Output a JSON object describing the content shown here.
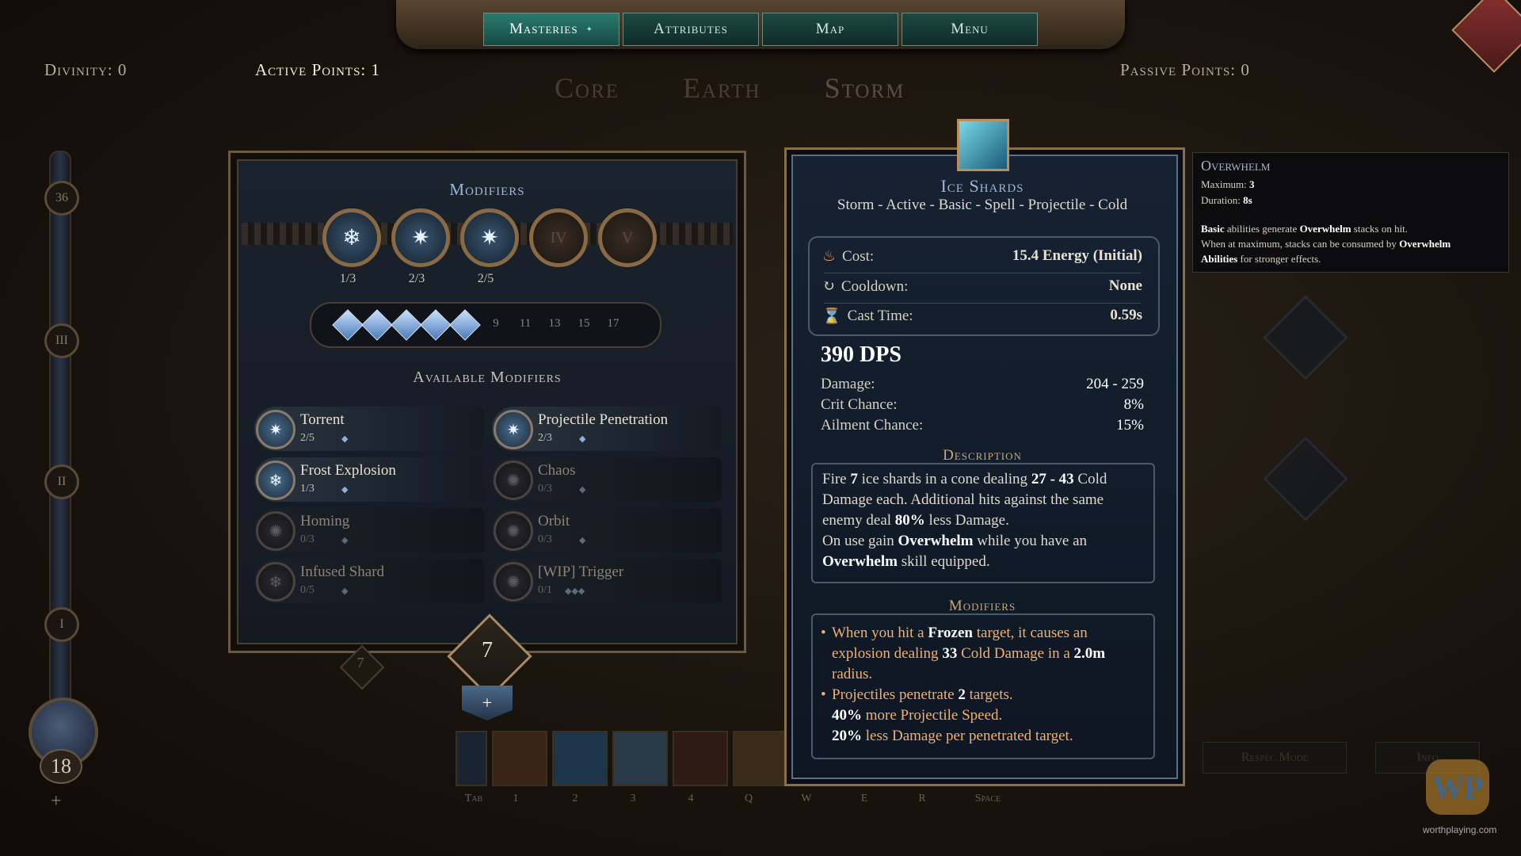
{
  "nav": {
    "tabs": [
      {
        "label": "Masteries",
        "active": true
      },
      {
        "label": "Attributes",
        "active": false
      },
      {
        "label": "Map",
        "active": false
      },
      {
        "label": "Menu",
        "active": false
      }
    ]
  },
  "header": {
    "divinity": "Divinity: 0",
    "active_points": "Active Points: 1",
    "passive_points": "Passive Points: 0",
    "tree_tabs": [
      "Core",
      "Earth",
      "Storm"
    ]
  },
  "sidebar": {
    "levels": [
      "36",
      "III",
      "II",
      "I"
    ],
    "orb_value": "18",
    "plus": "+"
  },
  "modifiers_panel": {
    "title": "Modifiers",
    "slots": [
      {
        "icon": "❄",
        "count": "1/3",
        "locked": false
      },
      {
        "icon": "✷",
        "count": "2/3",
        "locked": false
      },
      {
        "icon": "✷",
        "count": "2/5",
        "locked": false
      },
      {
        "icon": "IV",
        "count": "",
        "locked": true
      },
      {
        "icon": "V",
        "count": "",
        "locked": true
      }
    ],
    "gem_count_filled": 5,
    "gem_thresholds": [
      "9",
      "11",
      "13",
      "15",
      "17"
    ],
    "available_title": "Available Modifiers",
    "available": [
      {
        "name": "Torrent",
        "count": "2/5",
        "pips": "◆",
        "active": true
      },
      {
        "name": "Projectile Penetration",
        "count": "2/3",
        "pips": "◆",
        "active": true
      },
      {
        "name": "Frost Explosion",
        "count": "1/3",
        "pips": "◆",
        "active": true
      },
      {
        "name": "Chaos",
        "count": "0/3",
        "pips": "◆",
        "active": false
      },
      {
        "name": "Homing",
        "count": "0/3",
        "pips": "◆",
        "active": false
      },
      {
        "name": "Orbit",
        "count": "0/3",
        "pips": "◆",
        "active": false
      },
      {
        "name": "Infused Shard",
        "count": "0/5",
        "pips": "◆",
        "active": false
      },
      {
        "name": "[WIP] Trigger",
        "count": "0/1",
        "pips": "◆◆◆",
        "active": false
      }
    ],
    "badge_value": "7",
    "badge_small_value": "7",
    "plus": "+"
  },
  "skillbar": {
    "keys": [
      "Tab",
      "1",
      "2",
      "3",
      "4",
      "Q",
      "W",
      "E",
      "R",
      "Space"
    ],
    "slot_colors": [
      "#1a2430",
      "#3a2418",
      "#1e3448",
      "#2a3a48",
      "#2e1c14",
      "#3a2a1a"
    ]
  },
  "skill": {
    "name": "Ice Shards",
    "tags": "Storm - Active - Basic - Spell - Projectile - Cold",
    "stats": [
      {
        "label": "Cost:",
        "value": "15.4 Energy (Initial)",
        "icon": "energy-icon"
      },
      {
        "label": "Cooldown:",
        "value": "None",
        "icon": "cooldown-icon"
      },
      {
        "label": "Cast Time:",
        "value": "0.59s",
        "icon": "hourglass-icon"
      }
    ],
    "dps": "390 DPS",
    "damage_rows": [
      {
        "label": "Damage:",
        "value": "204 - 259"
      },
      {
        "label": "Crit Chance:",
        "value": "8%"
      },
      {
        "label": "Ailment Chance:",
        "value": "15%"
      }
    ],
    "description_title": "Description",
    "description": {
      "p1_a": "Fire ",
      "p1_b": "7",
      "p1_c": " ice shards in a cone dealing ",
      "p1_d": "27 - 43",
      "p1_e": " Cold Damage each. Additional hits against the same enemy deal ",
      "p1_f": "80%",
      "p1_g": " less Damage.",
      "p2_a": "On use gain ",
      "p2_b": "Overwhelm",
      "p2_c": " while you have an ",
      "p2_d": "Overwhelm",
      "p2_e": " skill equipped."
    },
    "modifiers_title": "Modifiers",
    "modifiers": {
      "m1_a": "When you hit a ",
      "m1_b": "Frozen",
      "m1_c": " target, it causes an explosion dealing ",
      "m1_d": "33",
      "m1_e": " Cold Damage in a ",
      "m1_f": "2.0m",
      "m1_g": " radius.",
      "m2_a": "Projectiles penetrate ",
      "m2_b": "2",
      "m2_c": " targets.",
      "m2_d": "40%",
      "m2_e": " more Projectile Speed.",
      "m2_f": "20%",
      "m2_g": " less Damage per penetrated target."
    }
  },
  "tooltip": {
    "title": "Overwhelm",
    "max_label": "Maximum: ",
    "max_value": "3",
    "dur_label": "Duration: ",
    "dur_value": "8s",
    "l1_a": "Basic",
    "l1_b": " abilities generate ",
    "l1_c": "Overwhelm",
    "l1_d": " stacks on hit.",
    "l2_a": "When at maximum, stacks can be consumed by ",
    "l2_b": "Overwhelm",
    "l2_c": "Abilities",
    "l2_d": " for stronger effects."
  },
  "ghost_buttons": {
    "respec": "Respec Mode",
    "info": "Info"
  },
  "watermark": {
    "logo": "WP",
    "text": "worthplaying.com"
  }
}
